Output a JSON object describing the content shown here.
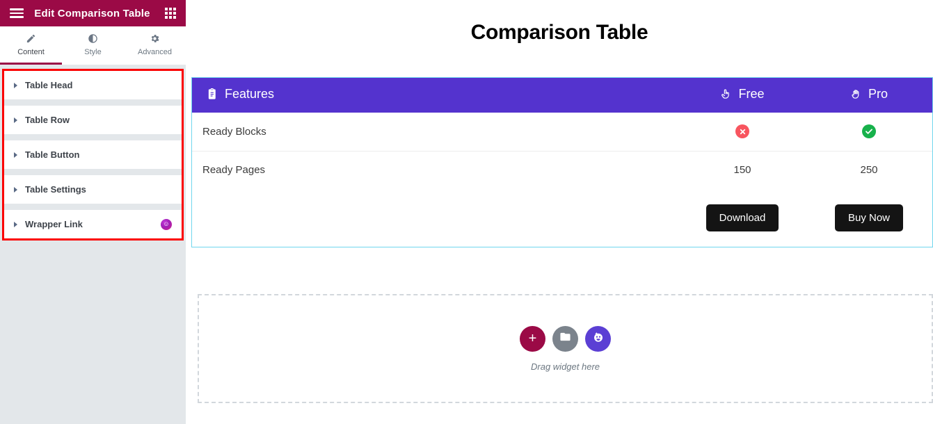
{
  "panel": {
    "header": {
      "title": "Edit Comparison Table",
      "menu_icon": "hamburger-icon",
      "apps_icon": "apps-grid-icon"
    },
    "tabs": [
      {
        "label": "Content",
        "icon": "pencil-icon",
        "active": true
      },
      {
        "label": "Style",
        "icon": "contrast-icon",
        "active": false
      },
      {
        "label": "Advanced",
        "icon": "gear-icon",
        "active": false
      }
    ],
    "accordion": [
      {
        "label": "Table Head",
        "badge": ""
      },
      {
        "label": "Table Row",
        "badge": ""
      },
      {
        "label": "Table Button",
        "badge": ""
      },
      {
        "label": "Table Settings",
        "badge": ""
      },
      {
        "label": "Wrapper Link",
        "badge": "happyaddons-badge-icon"
      }
    ],
    "highlight_color": "#fb0000",
    "collapse_icon": "‹"
  },
  "canvas": {
    "page_title": "Comparison Table",
    "table": {
      "header": [
        {
          "label": "Features",
          "icon": "clipboard-icon"
        },
        {
          "label": "Free",
          "icon": "pointing-hand-icon"
        },
        {
          "label": "Pro",
          "icon": "raised-hand-icon"
        }
      ],
      "rows": [
        {
          "feature": "Ready Blocks",
          "free": "cross-icon",
          "pro": "check-icon",
          "type": "icon"
        },
        {
          "feature": "Ready Pages",
          "free": "150",
          "pro": "250",
          "type": "text"
        }
      ],
      "buttons": [
        {
          "label": "Download"
        },
        {
          "label": "Buy Now"
        }
      ],
      "header_bg": "#5433ce",
      "button_bg": "#141414",
      "cross_color": "#f8555f",
      "check_color": "#17b14b",
      "selection_outline": "#6fd6ee"
    },
    "dropzone": {
      "label": "Drag widget here",
      "actions": [
        {
          "icon": "plus-icon",
          "color": "#9b0a46"
        },
        {
          "icon": "folder-icon",
          "color": "#7b838c"
        },
        {
          "icon": "widget-icon",
          "color": "#5b3fd4"
        }
      ]
    }
  }
}
